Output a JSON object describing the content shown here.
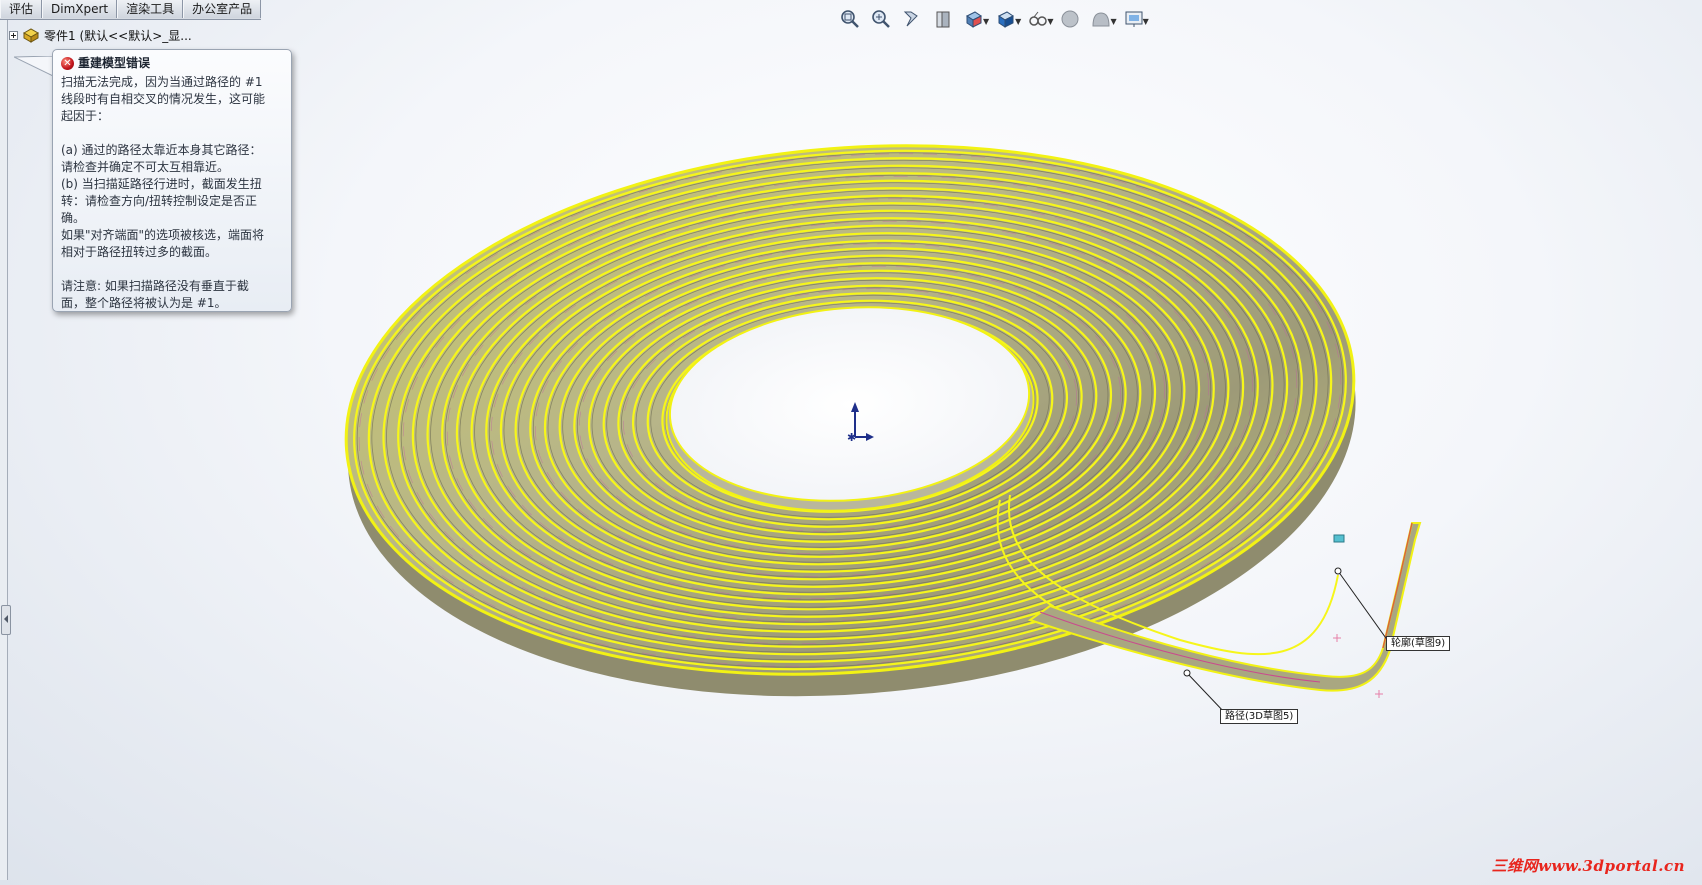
{
  "tabs": [
    "评估",
    "DimXpert",
    "渲染工具",
    "办公室产品"
  ],
  "tree": {
    "part_label": "零件1  (默认<<默认>_显..."
  },
  "error": {
    "title": "重建模型错误",
    "line1": "扫描无法完成，因为当通过路径的 #1\n线段时有自相交叉的情况发生，这可能\n起因于：",
    "line2": "(a) 通过的路径太靠近本身其它路径：\n请检查并确定不可太互相靠近。\n(b) 当扫描延路径行进时，截面发生扭\n转：请检查方向/扭转控制设定是否正\n确。\n如果\"对齐端面\"的选项被核选，端面将\n相对于路径扭转过多的截面。",
    "line3": "请注意: 如果扫描路径没有垂直于截\n面，整个路径将被认为是 #1。"
  },
  "toolbar": {
    "icons": [
      "zoom-to-fit-icon",
      "zoom-area-icon",
      "previous-view-icon",
      "section-view-icon",
      "view-orientation-icon",
      "display-style-icon",
      "hide-show-icon",
      "edit-appearance-icon",
      "apply-scene-icon",
      "view-settings-icon"
    ]
  },
  "callouts": {
    "profile": "轮廓(草图9)",
    "path": "路径(3D草图5)"
  },
  "watermark": "三维网www.3dportal.cn",
  "colors": {
    "coil_yellow": "#f2f214",
    "coil_shadow": "#8e8c6a",
    "background": "#f4f6fa",
    "watermark": "#e8251d"
  }
}
